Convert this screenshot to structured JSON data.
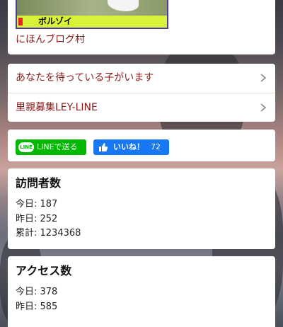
{
  "blog_ranking": {
    "banner_label": "ボルゾイ",
    "link_text": "にほんブログ村"
  },
  "links": [
    {
      "label": "あなたを待っている子がいます"
    },
    {
      "label": "里親募集LEY-LINE"
    }
  ],
  "share": {
    "line_logo": "LINE",
    "line_label": "LINEで送る",
    "like_label": "いいね！",
    "like_count": "72"
  },
  "visitors": {
    "title": "訪問者数",
    "today": "今日: 187",
    "yesterday": "昨日: 252",
    "total": "累計: 1234368"
  },
  "access": {
    "title": "アクセス数",
    "today": "今日: 378",
    "yesterday": "昨日: 585"
  },
  "colors": {
    "link": "#8b1a1a",
    "line_green": "#00b900",
    "facebook_blue": "#1877f2"
  },
  "icons": {
    "chevron": "chevron-right-icon",
    "thumb": "thumbs-up-icon"
  }
}
